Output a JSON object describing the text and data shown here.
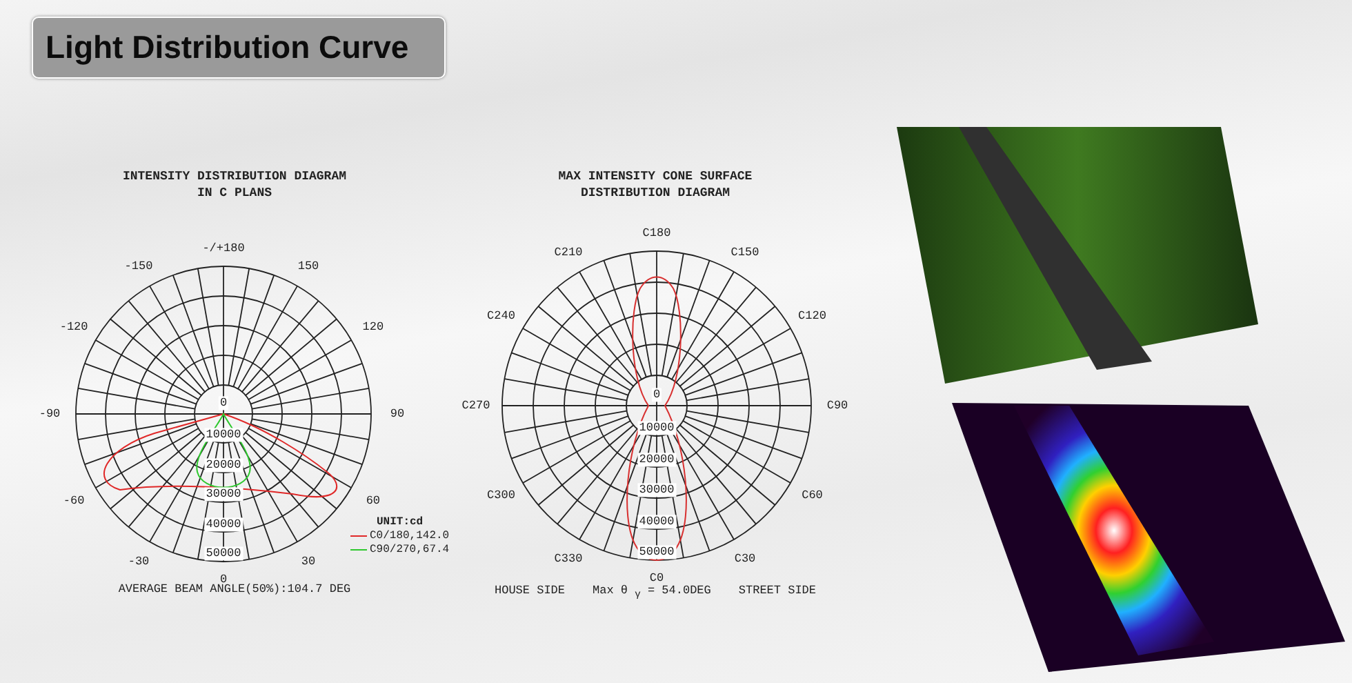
{
  "title": "Light Distribution Curve",
  "diagrams": [
    {
      "title_lines": [
        "INTENSITY DISTRIBUTION DIAGRAM",
        "IN C PLANS"
      ],
      "angle_labels": [
        "-/+180",
        "150",
        "120",
        "90",
        "60",
        "30",
        "0",
        "-30",
        "-60",
        "-90",
        "-120",
        "-150"
      ],
      "radial_labels": [
        "0",
        "10000",
        "20000",
        "30000",
        "40000",
        "50000"
      ],
      "unit": "UNIT:cd",
      "legend": [
        {
          "label": "C0/180,142.0",
          "color": "#e02828"
        },
        {
          "label": "C90/270,67.4",
          "color": "#2ec82e"
        }
      ],
      "footer": [
        "AVERAGE BEAM ANGLE(50%):104.7 DEG"
      ]
    },
    {
      "title_lines": [
        "MAX INTENSITY CONE SURFACE",
        "DISTRIBUTION DIAGRAM"
      ],
      "angle_labels": [
        "C180",
        "C150",
        "C120",
        "C90",
        "C60",
        "C30",
        "C0",
        "C330",
        "C300",
        "C270",
        "C240",
        "C210"
      ],
      "radial_labels": [
        "0",
        "10000",
        "20000",
        "30000",
        "40000",
        "50000"
      ],
      "footer": [
        "HOUSE SIDE",
        "Max θ $_{γ}$ = 54.0DEG",
        "STREET SIDE"
      ]
    }
  ]
}
